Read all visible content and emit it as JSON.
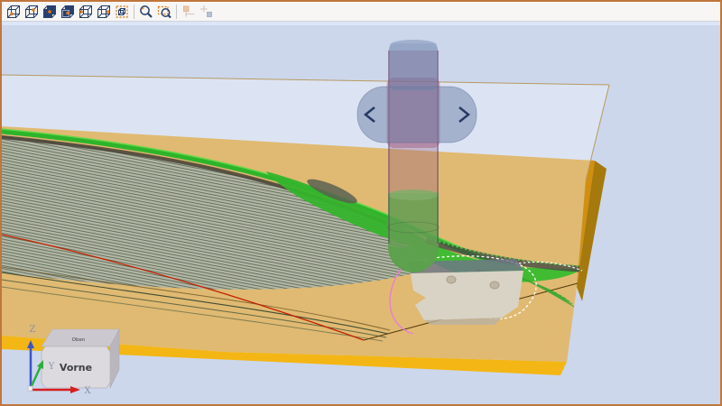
{
  "toolbar": {
    "icons": [
      {
        "name": "view-front-cube-icon",
        "enabled": true
      },
      {
        "name": "view-back-cube-icon",
        "enabled": true
      },
      {
        "name": "view-top-cube-icon",
        "enabled": true
      },
      {
        "name": "view-bottom-cube-icon",
        "enabled": true
      },
      {
        "name": "view-left-cube-icon",
        "enabled": true
      },
      {
        "name": "view-right-cube-icon",
        "enabled": true
      },
      {
        "name": "zoom-fit-icon",
        "enabled": true
      },
      {
        "name": "zoom-icon",
        "enabled": true
      },
      {
        "name": "zoom-window-icon",
        "enabled": true
      },
      {
        "name": "measure-point-icon",
        "enabled": false
      },
      {
        "name": "measure-distance-icon",
        "enabled": false
      }
    ]
  },
  "scene": {
    "view_cube": {
      "front_label": "Vorne",
      "top_label": "Oben"
    },
    "axes": {
      "x_label": "X",
      "y_label": "Y",
      "z_label": "Z",
      "x_color": "#d42020",
      "y_color": "#2fae3c",
      "z_color": "#3a55c8"
    },
    "colors": {
      "background": "#ccd7ec",
      "frame": "#c0763c",
      "stock_top": "#d28f0e",
      "stock_front": "#f4b614",
      "stock_side": "#a6790c",
      "machined_green": "#2db42b",
      "tool_tip_green": "#3ec72f",
      "toolpath_red": "#c32100",
      "toolpath_pink": "#e87fd2",
      "toolpath_white": "#ffffff",
      "fixture_beige": "#d9d3c6"
    }
  }
}
